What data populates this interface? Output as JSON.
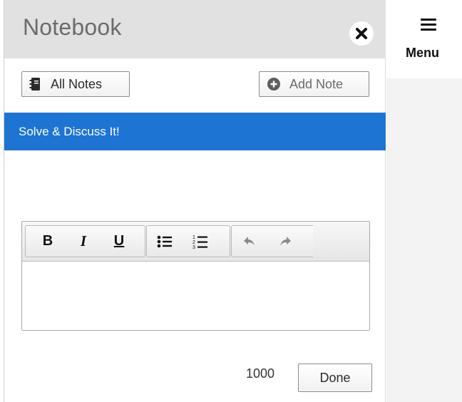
{
  "panel": {
    "title": "Notebook",
    "close_icon": "close-icon",
    "all_notes": {
      "label": "All Notes",
      "icon": "notebook-icon"
    },
    "add_note": {
      "label": "Add Note",
      "icon": "plus-circle-icon"
    },
    "current_note": "Solve & Discuss It!"
  },
  "editor": {
    "toolbar": [
      {
        "name": "bold-button",
        "label": "B"
      },
      {
        "name": "italic-button",
        "label": "I"
      },
      {
        "name": "underline-button",
        "label": "U"
      },
      {
        "name": "bulleted-list-button",
        "icon": "bulleted-list-icon"
      },
      {
        "name": "numbered-list-button",
        "icon": "numbered-list-icon"
      },
      {
        "name": "undo-button",
        "icon": "undo-icon"
      },
      {
        "name": "redo-button",
        "icon": "redo-icon"
      }
    ],
    "content": ""
  },
  "footer": {
    "char_count": "1000",
    "done_label": "Done"
  },
  "sidebar": {
    "menu_label": "Menu",
    "menu_icon": "hamburger-icon"
  },
  "colors": {
    "accent": "#1d74d3",
    "header_bg": "#e1e1e1",
    "title_text": "#6b6b6b"
  }
}
